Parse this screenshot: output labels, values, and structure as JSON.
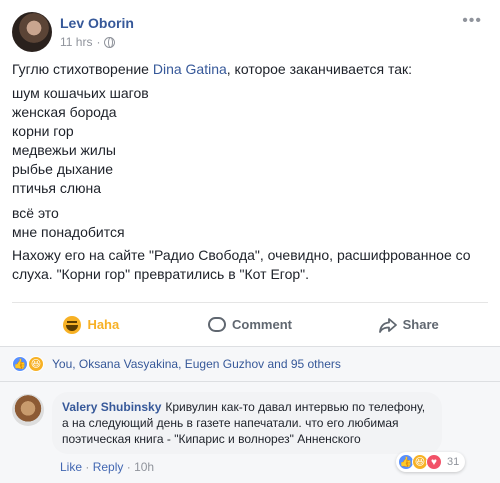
{
  "post": {
    "author": "Lev Oborin",
    "time": "11 hrs",
    "intro_before": "Гуглю стихотворение ",
    "mention": "Dina Gatina",
    "intro_after": ", которое заканчивается так:",
    "poem": [
      "шум кошачьих шагов",
      "женская борода",
      "корни гор",
      "медвежьи жилы",
      "рыбье дыхание",
      "птичья слюна"
    ],
    "coda": [
      "всё это",
      "мне понадобится"
    ],
    "outro": "Нахожу его на сайте \"Радио Свобода\", очевидно, расшифрованное со слуха. \"Корни гор\" превратились в \"Кот Егор\"."
  },
  "actions": {
    "haha": "Haha",
    "comment": "Comment",
    "share": "Share"
  },
  "reactions_summary": "You, Oksana Vasyakina, Eugen Guzhov and 95 others",
  "comment": {
    "author": "Valery Shubinsky",
    "text": "Кривулин как-то давал интервью по телефону, а на следующий день в газете напечатали. что его любимая поэтическая книга - \"Кипарис и волнорез\" Анненского",
    "like": "Like",
    "reply": "Reply",
    "time": "10h",
    "reaction_count": "31"
  },
  "colors": {
    "link": "#365899",
    "haha": "#f7b125",
    "like": "#5890ff",
    "love": "#f25268"
  }
}
